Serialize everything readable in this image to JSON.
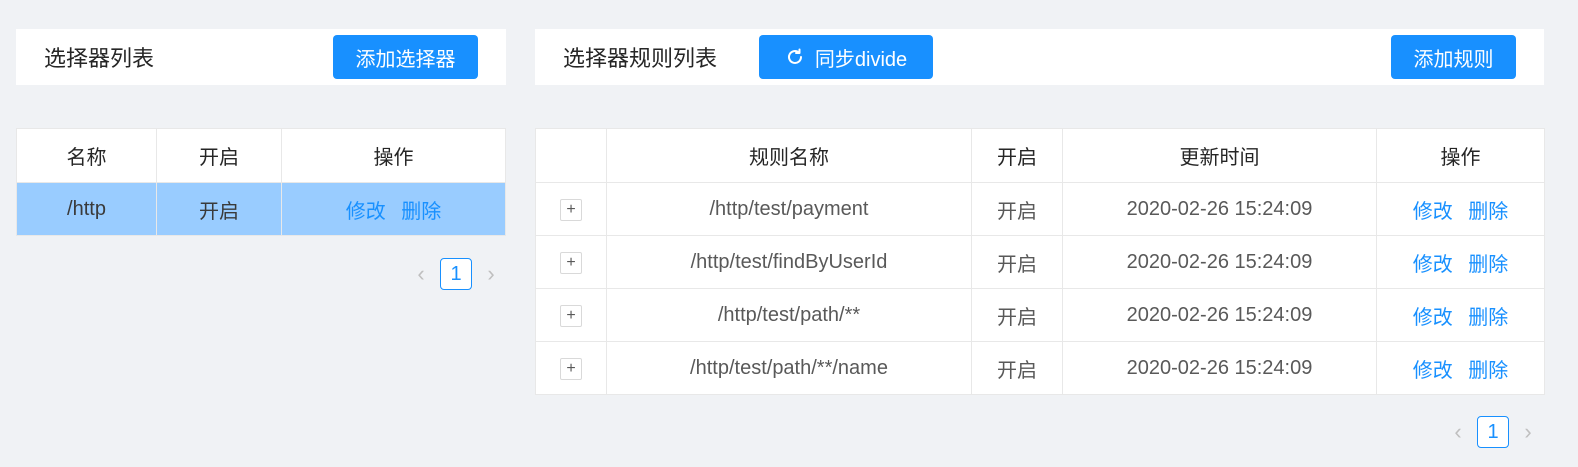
{
  "selector_panel": {
    "title": "选择器列表",
    "add_button": "添加选择器",
    "columns": [
      "名称",
      "开启",
      "操作"
    ],
    "rows": [
      {
        "name": "/http",
        "status": "开启",
        "edit": "修改",
        "delete": "删除"
      }
    ],
    "pagination": {
      "prev": "‹",
      "page": "1",
      "next": "›"
    }
  },
  "rule_panel": {
    "title": "选择器规则列表",
    "sync_button": "同步divide",
    "add_button": "添加规则",
    "columns": [
      "",
      "规则名称",
      "开启",
      "更新时间",
      "操作"
    ],
    "expand_symbol": "+",
    "rows": [
      {
        "name": "/http/test/payment",
        "status": "开启",
        "updated": "2020-02-26 15:24:09",
        "edit": "修改",
        "delete": "删除"
      },
      {
        "name": "/http/test/findByUserId",
        "status": "开启",
        "updated": "2020-02-26 15:24:09",
        "edit": "修改",
        "delete": "删除"
      },
      {
        "name": "/http/test/path/**",
        "status": "开启",
        "updated": "2020-02-26 15:24:09",
        "edit": "修改",
        "delete": "删除"
      },
      {
        "name": "/http/test/path/**/name",
        "status": "开启",
        "updated": "2020-02-26 15:24:09",
        "edit": "修改",
        "delete": "删除"
      }
    ],
    "pagination": {
      "prev": "‹",
      "page": "1",
      "next": "›"
    }
  },
  "colors": {
    "primary": "#1890ff",
    "status_on": "#19be6b",
    "selected_row": "#99ccff",
    "background": "#f0f2f5"
  },
  "icons": {
    "sync": "sync-icon",
    "prev": "chevron-left-icon",
    "next": "chevron-right-icon"
  }
}
